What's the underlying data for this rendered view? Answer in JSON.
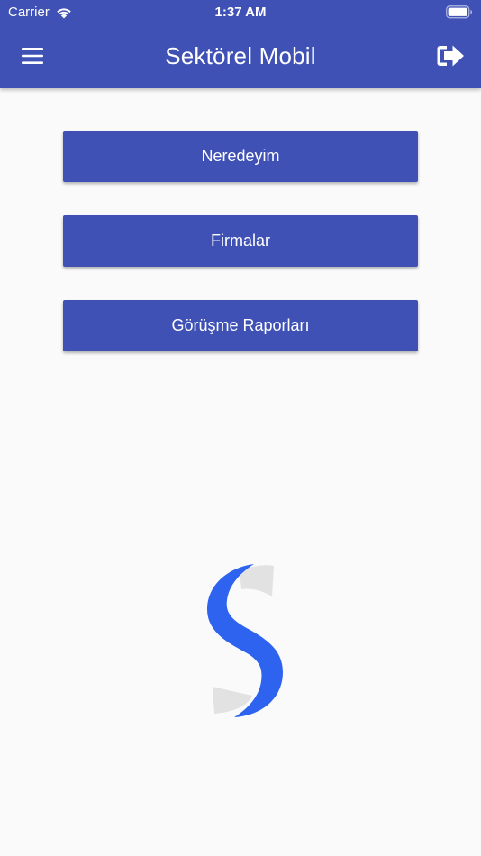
{
  "status_bar": {
    "carrier": "Carrier",
    "time": "1:37 AM",
    "icons": [
      "wifi-icon",
      "battery-icon"
    ]
  },
  "header": {
    "title": "Sektörel Mobil",
    "left_icon": "menu-icon",
    "right_icon": "logout-icon"
  },
  "menu": {
    "buttons": [
      {
        "label": "Neredeyim"
      },
      {
        "label": "Firmalar"
      },
      {
        "label": "Görüşme Raporları"
      }
    ]
  },
  "logo": {
    "icon": "s-logo-icon"
  },
  "colors": {
    "primary": "#3f51b5",
    "background": "#fafafa",
    "logo_blue": "#2e63f0",
    "logo_gray": "#e2e2e2"
  }
}
